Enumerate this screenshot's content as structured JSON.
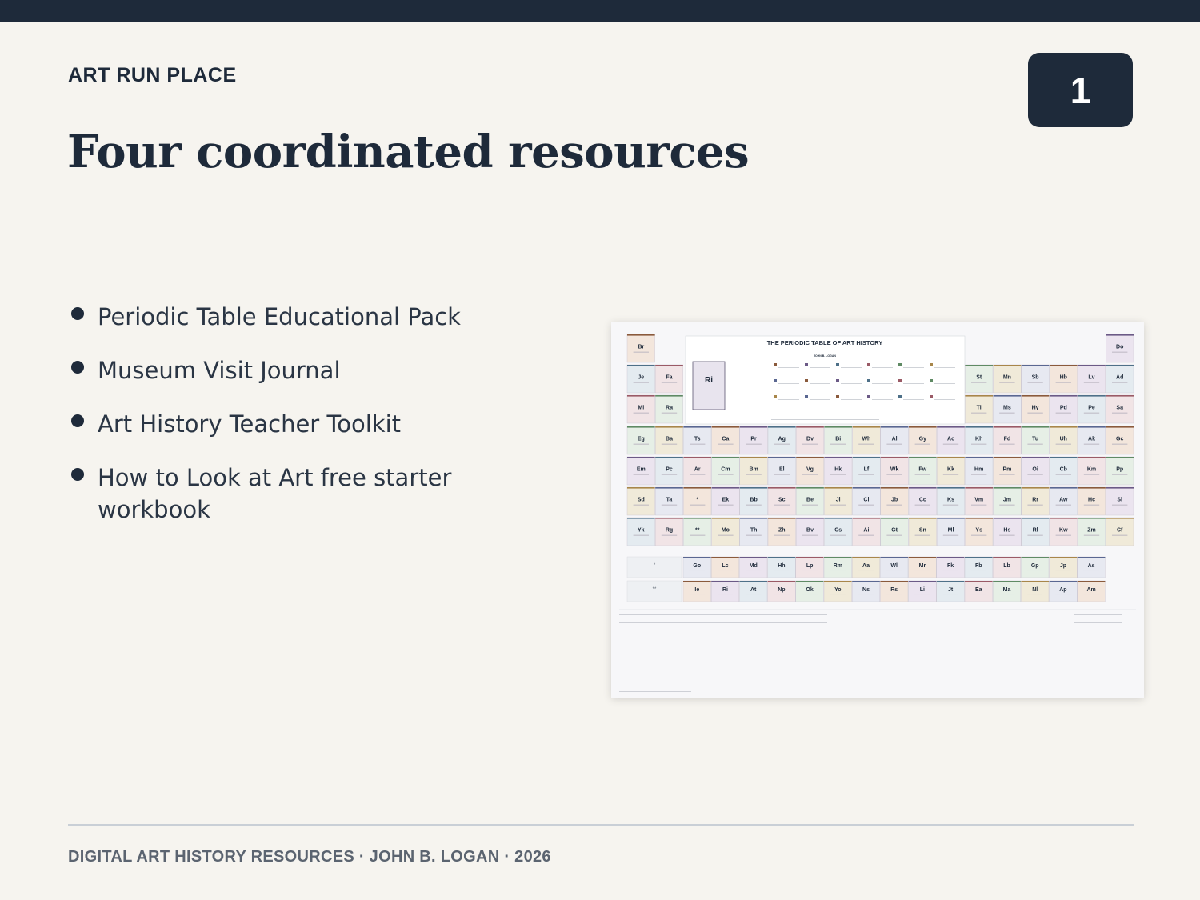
{
  "slide": {
    "kicker": "ART RUN PLACE",
    "title": "Four coordinated resources",
    "number": "1",
    "bullets": [
      "Periodic Table Educational Pack",
      "Museum Visit Journal",
      "Art History Teacher Toolkit",
      "How to Look at Art free starter workbook"
    ],
    "footer": "DIGITAL ART HISTORY RESOURCES · JOHN B. LOGAN · 2026"
  },
  "preview": {
    "title": "THE PERIODIC TABLE OF ART HISTORY",
    "author": "JOHN B. LOGAN",
    "key_symbol": "Ri",
    "row1": {
      "left": "Br",
      "right": "Do"
    },
    "row2": {
      "left": [
        "Je",
        "Fa"
      ],
      "right": [
        "St",
        "Mn",
        "Sb",
        "Hb",
        "Lv",
        "Ad"
      ]
    },
    "row3": {
      "left": [
        "Mi",
        "Ra"
      ],
      "right": [
        "Ti",
        "Ms",
        "Hy",
        "Pd",
        "Pe",
        "Sa"
      ]
    },
    "row4": [
      "Eg",
      "Ba",
      "Ts",
      "Ca",
      "Pr",
      "Ag",
      "Dv",
      "Bi",
      "Wh",
      "Al",
      "Gy",
      "Ac",
      "Kh",
      "Fd",
      "Tu",
      "Uh",
      "Ak",
      "Gc"
    ],
    "row5": [
      "Em",
      "Pc",
      "Ar",
      "Cm",
      "Bm",
      "El",
      "Vg",
      "Hk",
      "Lf",
      "Wk",
      "Fw",
      "Kk",
      "Hm",
      "Pm",
      "Oi",
      "Cb",
      "Km",
      "Pp"
    ],
    "row6": [
      "Sd",
      "Ta",
      "*",
      "Ek",
      "Bb",
      "Sc",
      "Be",
      "Jl",
      "Cl",
      "Jb",
      "Cc",
      "Ks",
      "Vm",
      "Jm",
      "Rr",
      "Aw",
      "Hc",
      "Sl"
    ],
    "row7": [
      "Yk",
      "Rg",
      "**",
      "Mo",
      "Th",
      "Zh",
      "Bv",
      "Cs",
      "Ai",
      "Gt",
      "Sn",
      "Ml",
      "Ys",
      "Hs",
      "Rl",
      "Kw",
      "Zm",
      "Cf"
    ],
    "series_a": [
      "Go",
      "Lc",
      "Md",
      "Hh",
      "Lp",
      "Rm",
      "Aa",
      "Wl",
      "Mr",
      "Fk",
      "Fb",
      "Lb",
      "Gp",
      "Jp",
      "As"
    ],
    "series_b": [
      "Ie",
      "Ri",
      "At",
      "Np",
      "Ok",
      "Yo",
      "Ns",
      "Rs",
      "Li",
      "Jt",
      "Ea",
      "Ma",
      "Nl",
      "Ap",
      "Am"
    ],
    "series_a_mark": "*",
    "series_b_mark": "**"
  }
}
